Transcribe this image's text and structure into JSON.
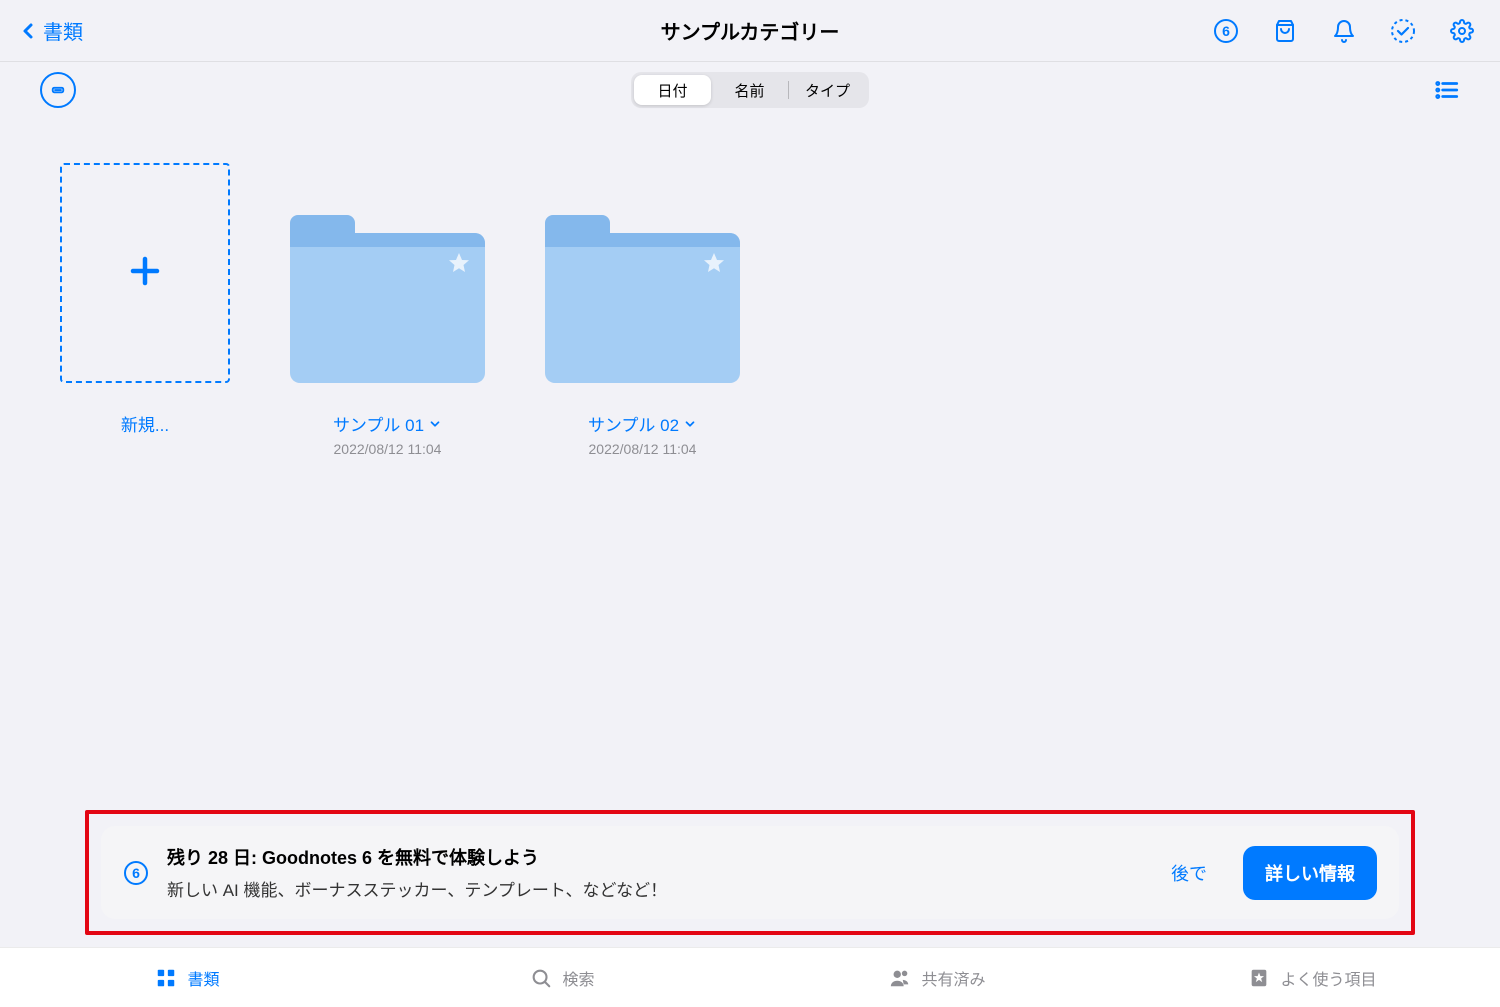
{
  "nav": {
    "back_label": "書類",
    "title": "サンプルカテゴリー",
    "badge_value": "6"
  },
  "toolbar": {
    "seg": {
      "date": "日付",
      "name": "名前",
      "type": "タイプ"
    }
  },
  "grid": {
    "new_label": "新規...",
    "folders": [
      {
        "name": "サンプル 01",
        "date": "2022/08/12 11:04"
      },
      {
        "name": "サンプル 02",
        "date": "2022/08/12 11:04"
      }
    ]
  },
  "promo": {
    "title": "残り 28 日: Goodnotes 6 を無料で体験しよう",
    "subtitle": "新しい AI 機能、ボーナスステッカー、テンプレート、などなど！",
    "later": "後で",
    "cta": "詳しい情報",
    "badge_value": "6"
  },
  "tabs": {
    "docs": "書類",
    "search": "検索",
    "shared": "共有済み",
    "fav": "よく使う項目"
  }
}
